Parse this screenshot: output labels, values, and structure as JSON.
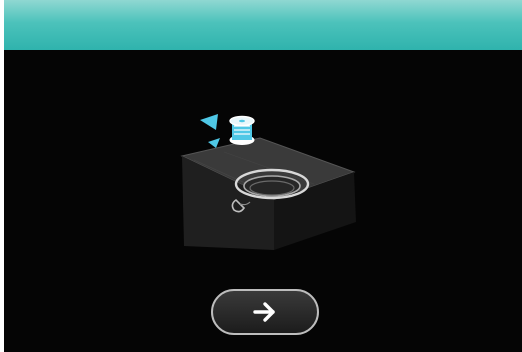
{
  "screen": {
    "background_color": "#050505",
    "header": {
      "color_top": "#8fd8d2",
      "color_bottom": "#2fb3ad"
    },
    "illustration": {
      "icons": [
        "bobbin-icon",
        "needle-plate-icon",
        "bobbin-case-icon"
      ],
      "accent_color": "#4fc8e6"
    },
    "next_button": {
      "icon": "arrow-right-icon"
    }
  }
}
